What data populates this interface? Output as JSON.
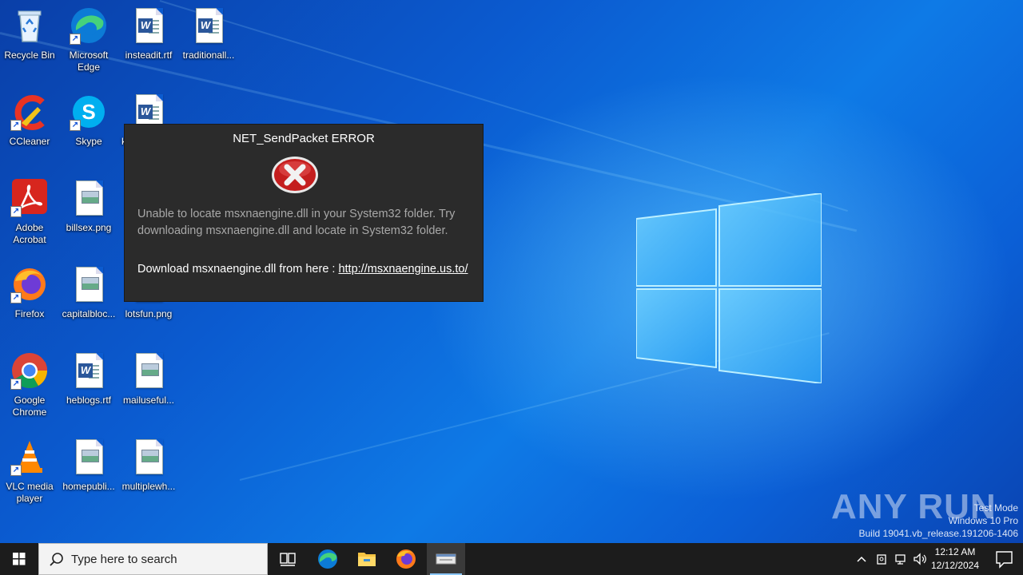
{
  "desktop_icons": [
    {
      "label": "Recycle Bin",
      "icon": "recycle-bin-icon"
    },
    {
      "label": "Microsoft Edge",
      "icon": "edge-icon"
    },
    {
      "label": "insteadit.rtf",
      "icon": "word-doc-icon"
    },
    {
      "label": "traditionall...",
      "icon": "word-doc-icon"
    },
    {
      "label": "CCleaner",
      "icon": "ccleaner-icon"
    },
    {
      "label": "Skype",
      "icon": "skype-icon"
    },
    {
      "label": "Adobe Acrobat",
      "icon": "acrobat-icon"
    },
    {
      "label": "billsex.png",
      "icon": "image-file-icon"
    },
    {
      "label": "Firefox",
      "icon": "firefox-icon"
    },
    {
      "label": "capitalbloc...",
      "icon": "image-file-icon"
    },
    {
      "label": "lotsfun.png",
      "icon": "image-file-icon"
    },
    {
      "label": "Google Chrome",
      "icon": "chrome-icon"
    },
    {
      "label": "heblogs.rtf",
      "icon": "word-doc-icon"
    },
    {
      "label": "mailuseful...",
      "icon": "image-file-icon"
    },
    {
      "label": "VLC media player",
      "icon": "vlc-icon"
    },
    {
      "label": "homepubli...",
      "icon": "image-file-icon"
    },
    {
      "label": "multiplewh...",
      "icon": "image-file-icon"
    },
    {
      "label": "k",
      "icon": "word-doc-icon"
    }
  ],
  "dialog": {
    "title": "NET_SendPacket ERROR",
    "message": "Unable to locate msxnaengine.dll in your System32 folder. Try downloading msxnaengine.dll and locate in System32 folder.",
    "download_prefix": "Download msxnaengine.dll from here : ",
    "download_link": " http://msxnaengine.us.to/"
  },
  "watermark": {
    "brand": "ANY RUN",
    "line1": "Test Mode",
    "line2": "Windows 10 Pro",
    "line3": "Build 19041.vb_release.191206-1406"
  },
  "taskbar": {
    "search_placeholder": "Type here to search",
    "time": "12:12 AM",
    "date": "12/12/2024",
    "pinned": [
      "task-view",
      "edge",
      "file-explorer",
      "firefox",
      "active-window"
    ]
  },
  "colors": {
    "desktop_blue": "#0b5bd0",
    "dialog_bg": "#2b2b2b",
    "taskbar_bg": "#1c1c1c"
  }
}
